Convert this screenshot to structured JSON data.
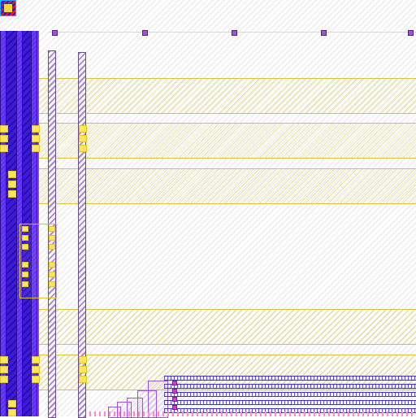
{
  "ui": {
    "canvas": "layout-canvas",
    "hatch_color": "#e6e6e6",
    "highlight_color": "#d8c23f",
    "metal_color": "#3f1ad0",
    "rail_color": "#a889c8",
    "via_color": "#9d53d3",
    "bottom_color": "#5a52d0",
    "pad_color": "#ffe45c",
    "pink_color": "#ff88cc"
  }
}
